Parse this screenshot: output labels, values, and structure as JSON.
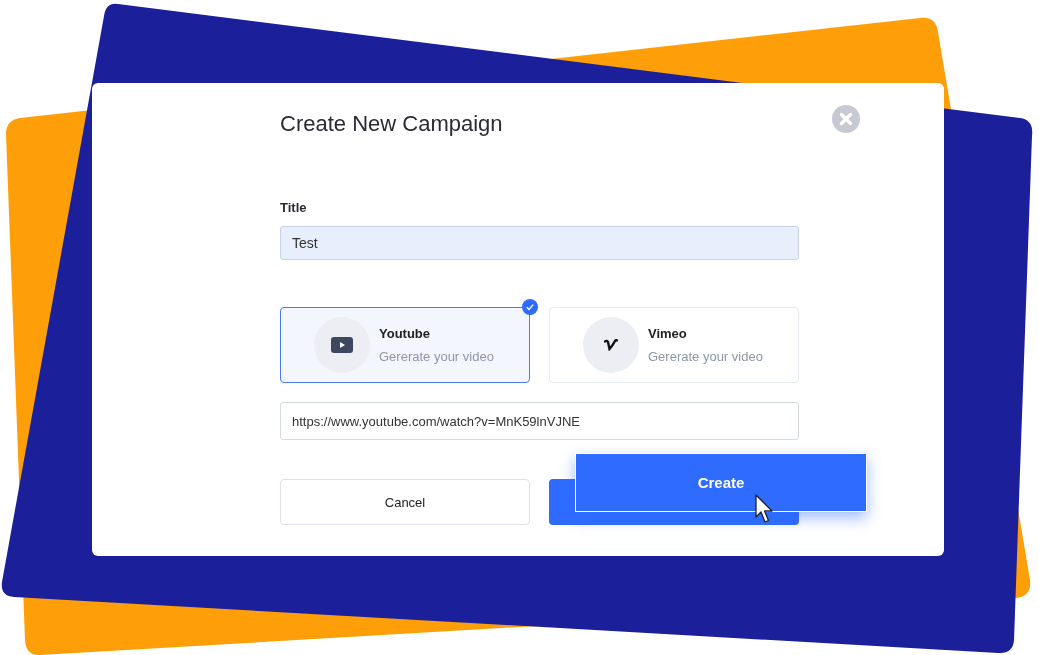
{
  "dialog": {
    "title": "Create New Campaign"
  },
  "title_field": {
    "label": "Title",
    "value": "Test"
  },
  "providers": [
    {
      "kind": "youtube",
      "name": "Youtube",
      "subtitle": "Gererate your video",
      "selected": true
    },
    {
      "kind": "vimeo",
      "name": "Vimeo",
      "subtitle": "Gererate your video",
      "selected": false
    }
  ],
  "url_field": {
    "value": "https://www.youtube.com/watch?v=MnK59lnVJNE"
  },
  "buttons": {
    "cancel": "Cancel",
    "create": "Create"
  }
}
